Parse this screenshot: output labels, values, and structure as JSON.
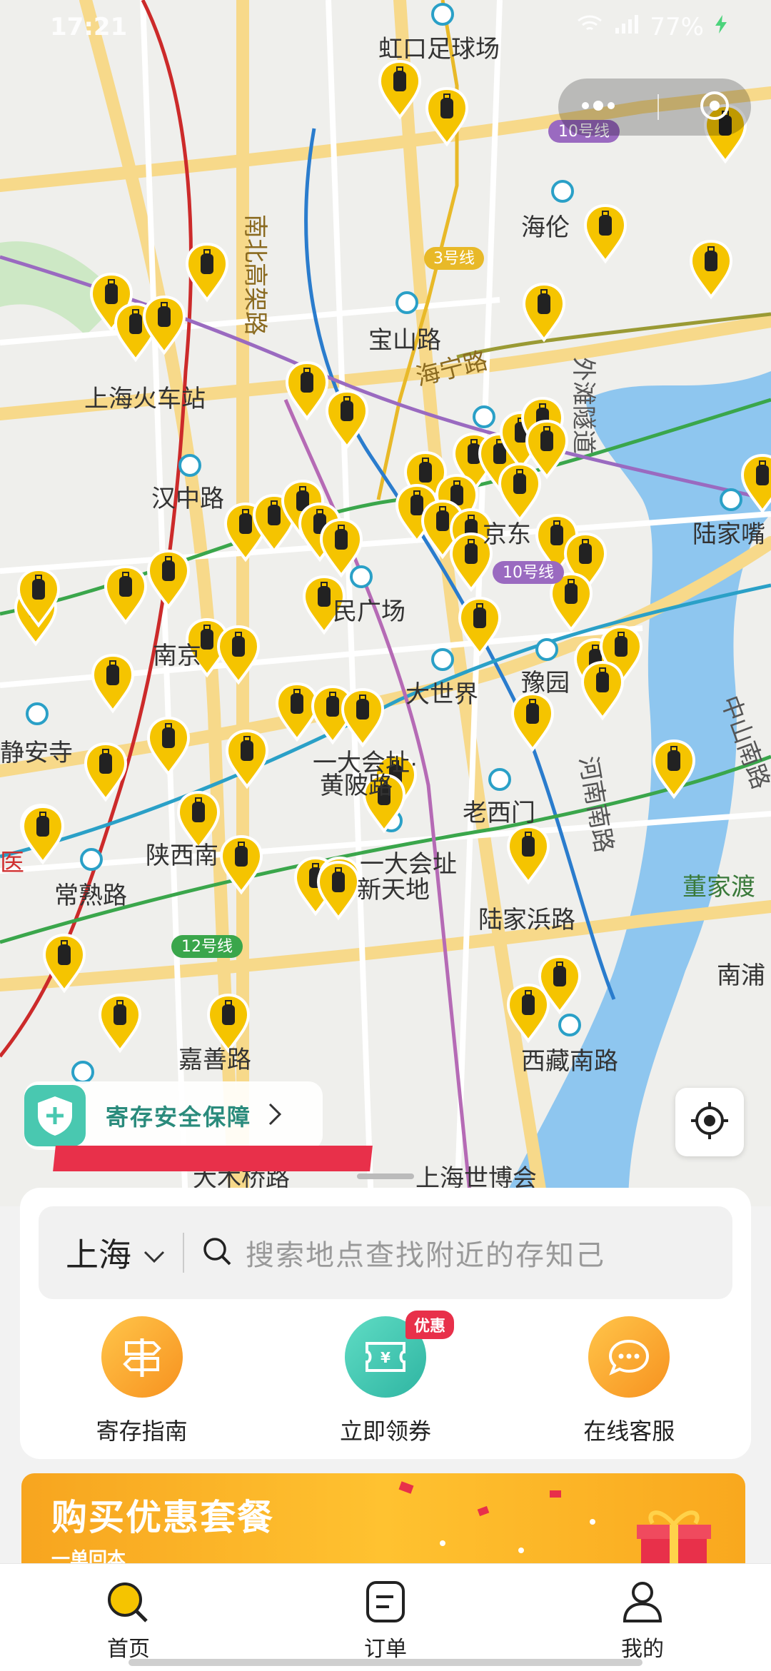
{
  "status_bar": {
    "time": "17:21",
    "battery": "77%"
  },
  "colors": {
    "accent": "#f5c400",
    "brand_teal": "#49c8b0",
    "badge_red": "#e8304a",
    "water": "#8ec6ef",
    "road": "#f7d98a"
  },
  "map": {
    "labels": {
      "hongkou_stadium": "虹口足球场",
      "nanbei_elevated": "南北高架路",
      "line3": "3号线",
      "line10_top": "10号线",
      "hailun": "海伦",
      "baoshan_rd": "宝山路",
      "haining_rd": "海宁路",
      "waitan_tunnel": "外滩隧道",
      "shanghai_station": "上海火车站",
      "hanzhong_rd": "汉中路",
      "lujiazui": "陆家嘴",
      "nanjing_east": "京东",
      "line10_mid": "10号线",
      "peoples_square": "民广场",
      "nanjing_west": "南京",
      "dashijie": "大世界",
      "yuyuan": "豫园",
      "jingan_temple": "静安寺",
      "dahuizhi": "一大会址·",
      "huangpi_rd": "黄陂路",
      "laoximen": "老西门",
      "henan_south": "河南南路",
      "zhongshan_south": "中山南路",
      "shaanxi_south": "陕西南",
      "dahuizhi_xintiandi_1": "一大会址",
      "dahuizhi_xintiandi_2": "新天地",
      "changshu_rd": "常熟路",
      "lujiabang_rd": "陆家浜路",
      "dongjiadu": "董家渡",
      "line12": "12号线",
      "nanpu": "南浦",
      "jiashan_rd": "嘉善路",
      "xizang_south": "西藏南路",
      "expo": "上海世博会",
      "dalian_bridge": "大木桥路",
      "hospital": "医"
    }
  },
  "top_capsule": {
    "more_icon": "more-dots-icon",
    "close_icon": "target-circle-icon"
  },
  "safety": {
    "label": "寄存安全保障"
  },
  "search": {
    "city": "上海",
    "placeholder": "搜索地点查找附近的存知己"
  },
  "actions": [
    {
      "label": "寄存指南",
      "icon": "signpost-icon",
      "color": "#f7a51f"
    },
    {
      "label": "立即领券",
      "icon": "coupon-icon",
      "color": "#49c8b0",
      "badge": "优惠"
    },
    {
      "label": "在线客服",
      "icon": "chat-icon",
      "color": "#f7a51f"
    }
  ],
  "banner": {
    "title": "购买优惠套餐",
    "subtitle": "一单回本"
  },
  "tabs": [
    {
      "label": "首页",
      "icon": "search-icon",
      "active": true
    },
    {
      "label": "订单",
      "icon": "order-icon",
      "active": false
    },
    {
      "label": "我的",
      "icon": "user-icon",
      "active": false
    }
  ]
}
